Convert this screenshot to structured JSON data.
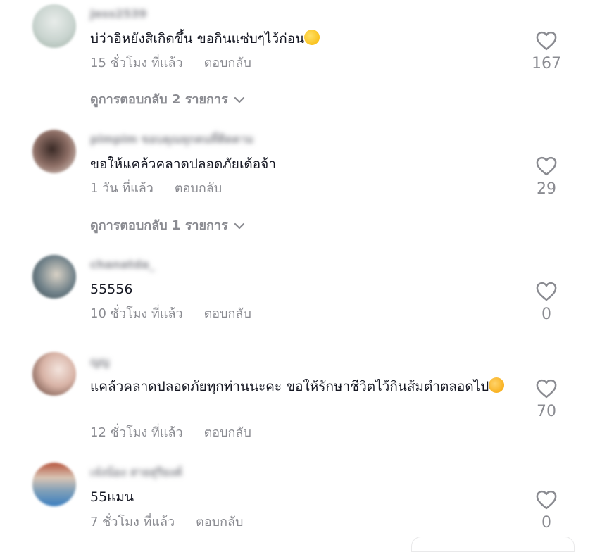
{
  "comments": [
    {
      "username": "Jess2539",
      "text": "บ่ว่าอิหยังสิเกิดขึ้น ขอกินแซ่บๆไว้ก่อน",
      "emoji": "rofl-emoji",
      "time": "15 ชั่วโมง ที่แล้ว",
      "reply_label": "ตอบกลับ",
      "likes": "167",
      "view_replies": "ดูการตอบกลับ 2 รายการ",
      "avatar_color": "#c9d4cf"
    },
    {
      "username": "pimpim ขอบคุณทุกคนที่ติดตาม",
      "text": "ขอให้แคล้วคลาดปลอดภัยเด้อจ้า",
      "time": "1 วัน ที่แล้ว",
      "reply_label": "ตอบกลับ",
      "likes": "29",
      "view_replies": "ดูการตอบกลับ 1 รายการ",
      "avatar_color": "#8e6f66"
    },
    {
      "username": "chanatda_",
      "text": "55556",
      "time": "10 ชั่วโมง ที่แล้ว",
      "reply_label": "ตอบกลับ",
      "likes": "0",
      "avatar_color": "#6f8088"
    },
    {
      "username": "ญญ",
      "text": "แคล้วคลาดปลอดภัยทุกท่านนะคะ ขอให้รักษาชีวิตไว้กินส้มตำตลอดไป",
      "emoji": "smiling-face-with-hearts-emoji",
      "time": "12 ชั่วโมง ที่แล้ว",
      "reply_label": "ตอบกลับ",
      "likes": "70",
      "avatar_color": "#d8b3a6"
    },
    {
      "username": "เจ๋งน้อง สายสุริยงค์",
      "text": "55แมน",
      "time": "7 ชั่วโมง ที่แล้ว",
      "reply_label": "ตอบกลับ",
      "likes": "0",
      "avatar_color": "#7f9fb8"
    }
  ],
  "colors": {
    "text_primary": "#161823",
    "text_secondary": "#8a8b91",
    "background": "#ffffff"
  }
}
